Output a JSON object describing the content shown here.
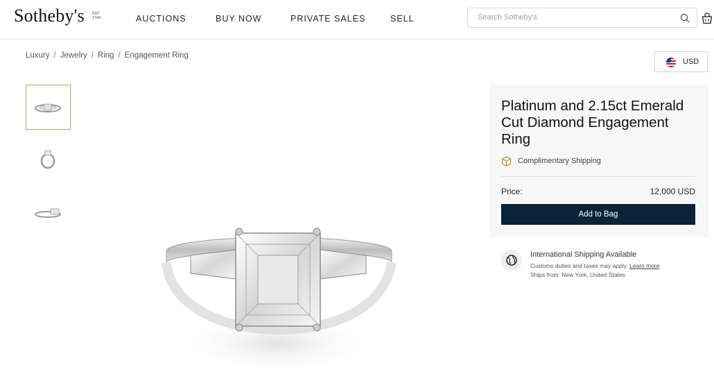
{
  "header": {
    "logo": "Sotheby's",
    "logo_est": "EST 1744",
    "nav": [
      "AUCTIONS",
      "BUY NOW",
      "PRIVATE SALES",
      "SELL"
    ],
    "search_placeholder": "Search Sotheby's",
    "search_icon": "search-icon",
    "bag_icon": "shopping-bag-icon"
  },
  "breadcrumb": [
    "Luxury",
    "Jewelry",
    "Ring",
    "Engagement Ring"
  ],
  "currency": {
    "label": "USD",
    "flag": "us-flag-icon"
  },
  "thumbnails": [
    "ring-front-view",
    "ring-side-view",
    "ring-profile-view"
  ],
  "product": {
    "title": "Platinum and 2.15ct Emerald Cut Diamond Engagement Ring",
    "shipping": "Complimentary Shipping",
    "price_label": "Price:",
    "price_value": "12,000 USD",
    "add_to_bag": "Add to Bag"
  },
  "international": {
    "title": "International Shipping Available",
    "duties_text": "Customs duties and taxes may apply.",
    "learn_more": "Learn more",
    "ships_from": "Ships from: New York, United States"
  },
  "colors": {
    "accent_navy": "#0b2338",
    "thumb_border": "#b8a35a",
    "panel_bg": "#f7f7f7"
  }
}
